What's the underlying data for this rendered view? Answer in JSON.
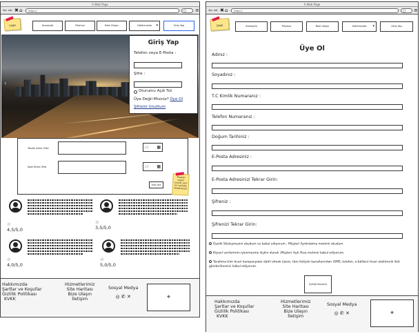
{
  "browser": {
    "tab_title": "A Web Page",
    "url": "https://",
    "back_icon": "left-arrow-icon",
    "forward_icon": "right-arrow-icon",
    "close_icon": "x-icon",
    "home_icon": "home-icon",
    "search_icon": "search-icon",
    "menu_icon": "hamburger-icon"
  },
  "nav": {
    "logo": "Logo",
    "items": [
      "Anasayfa",
      "Filomuz",
      "Bize Ulaşın",
      "Hakkımızda",
      "Giriş Yap"
    ]
  },
  "login": {
    "title": "Giriş Yap",
    "user_label": "Telefon veya E-Posta :",
    "password_label": "Şifre :",
    "remember": "Oturumu Açık Tut",
    "not_member": "Üye Değil Misiniz?",
    "register_link": "Üye Ol",
    "forgot": "Şifremi Unuttum"
  },
  "booking": {
    "pickup_label": "Teslim Alma Ofisi",
    "return_label": "İade Etme Ofisi",
    "date_placeholder": "/ /",
    "search_button": "Araç Ara",
    "sticky_note": "Filodaki uygun araçlar yeni bir sayfada listelenecek"
  },
  "reviews": [
    {
      "rating": "4,5/5,0"
    },
    {
      "rating": "3,5/5,0"
    },
    {
      "rating": "4,0/5,0"
    },
    {
      "rating": "5,0/5,0"
    }
  ],
  "footer": {
    "col1": [
      "Hakkımızda",
      "Şartlar ve Koşullar",
      "Gizlilik Politikası",
      "KVKK"
    ],
    "col2": [
      "Hizmetlerimiz",
      "Site Haritası",
      "Bize Ulaşın",
      "İletişim"
    ],
    "social_title": "Sosyal Medya",
    "social_icons": [
      "instagram-icon",
      "whatsapp-icon",
      "x-twitter-icon"
    ],
    "map_icon": "map-pin-icon"
  },
  "register": {
    "title": "Üye Ol",
    "fields": [
      "Adınız :",
      "Soyadınız :",
      "T.C Kimlik Numaranız :",
      "Telefon Numaranız :",
      "Doğum Tarihiniz :",
      "E-Posta Adresiniz :",
      "E-Posta Adresinizi Tekrar Girin:",
      "Şifreniz :",
      "Şifrenizi Tekrar Girin:"
    ],
    "consents": [
      "Üyelik Sözleşmesini okudum ve kabul ediyorum , Müşteri Aydınlatma metnini okudum",
      "Kişisel verilerimin işlenmesine ilişkin olarak ,Müşteri Açık Rıza metnini kabul ediyorum.",
      "Tarafıma tüm ticari kampanyalar dahil olmak üzere, tüm iletişim kanallarından (SMS, telefon, e-bülten) ticari elektronik ileti gönderilmesini kabul ediyorum."
    ],
    "submit": "Üyeliği Tamamla"
  }
}
